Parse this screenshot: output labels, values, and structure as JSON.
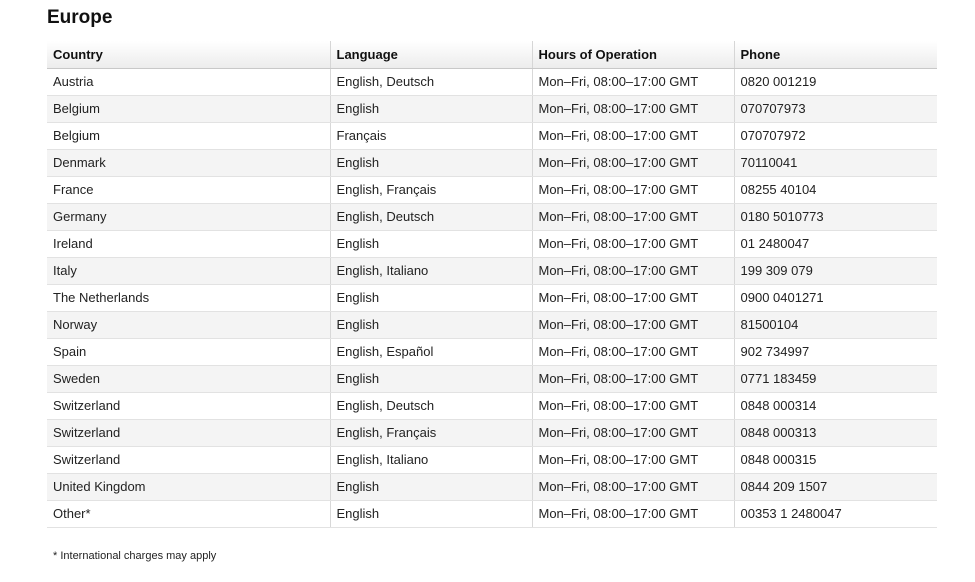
{
  "title": "Europe",
  "table": {
    "headers": [
      "Country",
      "Language",
      "Hours of Operation",
      "Phone"
    ],
    "rows": [
      [
        "Austria",
        "English, Deutsch",
        "Mon–Fri, 08:00–17:00 GMT",
        "0820 001219"
      ],
      [
        "Belgium",
        "English",
        "Mon–Fri, 08:00–17:00 GMT",
        "070707973"
      ],
      [
        "Belgium",
        "Français",
        "Mon–Fri, 08:00–17:00 GMT",
        "070707972"
      ],
      [
        "Denmark",
        "English",
        "Mon–Fri, 08:00–17:00 GMT",
        "70110041"
      ],
      [
        "France",
        "English, Français",
        "Mon–Fri, 08:00–17:00 GMT",
        "08255 40104"
      ],
      [
        "Germany",
        "English, Deutsch",
        "Mon–Fri, 08:00–17:00 GMT",
        "0180 5010773"
      ],
      [
        "Ireland",
        "English",
        "Mon–Fri, 08:00–17:00 GMT",
        "01 2480047"
      ],
      [
        "Italy",
        "English, Italiano",
        "Mon–Fri, 08:00–17:00 GMT",
        "199 309 079"
      ],
      [
        "The Netherlands",
        "English",
        "Mon–Fri, 08:00–17:00 GMT",
        "0900 0401271"
      ],
      [
        "Norway",
        "English",
        "Mon–Fri, 08:00–17:00 GMT",
        "81500104"
      ],
      [
        "Spain",
        "English, Español",
        "Mon–Fri, 08:00–17:00 GMT",
        "902 734997"
      ],
      [
        "Sweden",
        "English",
        "Mon–Fri, 08:00–17:00 GMT",
        "0771 183459"
      ],
      [
        "Switzerland",
        "English, Deutsch",
        "Mon–Fri, 08:00–17:00 GMT",
        "0848 000314"
      ],
      [
        "Switzerland",
        "English, Français",
        "Mon–Fri, 08:00–17:00 GMT",
        "0848 000313"
      ],
      [
        "Switzerland",
        "English, Italiano",
        "Mon–Fri, 08:00–17:00 GMT",
        "0848 000315"
      ],
      [
        "United Kingdom",
        "English",
        "Mon–Fri, 08:00–17:00 GMT",
        "0844 209 1507"
      ],
      [
        "Other*",
        "English",
        "Mon–Fri, 08:00–17:00 GMT",
        "00353 1 2480047"
      ]
    ]
  },
  "footnote": "* International charges may apply"
}
